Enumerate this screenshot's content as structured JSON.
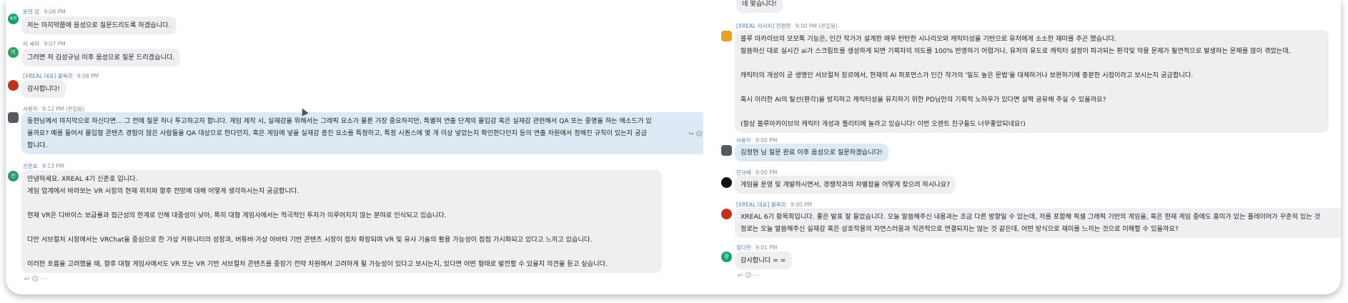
{
  "left": {
    "messages": [
      {
        "sender": "동현 강",
        "time": "9:06 PM",
        "avatar_text": "동현",
        "avatar_color": "#12a46e",
        "lines": [
          "저는 마지막쯤에 음성으로 질문드리도록 하겠습니다."
        ]
      },
      {
        "sender": "이 세라",
        "time": "9:07 PM",
        "avatar_text": "이",
        "avatar_color": "#2aa061",
        "lines": [
          "그러면 저 김성규님 이후 음성으로 질문 드리겠습니다."
        ]
      },
      {
        "sender": "[XREAL 대표] 황목희",
        "time": "9:08 PM",
        "avatar_text": "",
        "avatar_color": "#c0321e",
        "lines": [
          "감사합니다!"
        ]
      },
      {
        "sender": "사용자",
        "time": "9:12 PM (편집됨)",
        "avatar_text": "",
        "avatar_color": "#555a60",
        "lines": [
          "동현님께서 마지막으로 하신다면... 그 전에 질문 하나 투고하고자 합니다. 게임 제작 시, 실재감을 위해서는 그래픽 요소가 물론 가장 중요하지만, 특별히 연출 단계의 몰입감 혹은 실재감 관련해서 QA 또는 중명을 하는 메소드가 있",
          "을까요? 예를 들어서 몰입형 콘텐츠 경험이 많은 사람들을 QA 대상으로 한다던지, 혹은 게임에 넣을 실재감 증진 요소를 특정하고, 특정 시퀀스에 몇 개 이상 넣었는지 확인한다던지 등의 연출 차원에서 정해진 규칙이 있는지 궁금",
          "합니다."
        ]
      },
      {
        "sender": "신준호",
        "time": "9:13 PM",
        "avatar_text": "신",
        "avatar_color": "#2a9a68",
        "lines": [
          "안녕하세요. XREAL 4기 신준호 입니다.",
          "게임 업계에서 바라보는 VR 시장의 현재 위치와 향후 전망에 대해 어떻게 생각하시는지 궁금합니다.",
          "현재 VR은 디바이스 보급률과 접근성의 한계로 인해 대중성이 낮아, 특히 대형 게임사에서는 적극적인 투자가 이루어지지 않는 분야로 인식되고 있습니다.",
          "다만 서브컬처 시장에서는 VRChat을 중심으로 한 가상 커뮤니티의 성장과, 버튜버·가상 아바타 기반 콘텐츠 시장이 점차 확장되며 VR 및 유사 기술의 활용 가능성이 점점 가시화되고 있다고 느끼고 있습니다.",
          "이러한 흐름을 고려했을 때, 향후 대형 게임사에서도 VR 또는 VR 기반 서브컬처 콘텐츠를 중장기 전략 차원에서 고려하게 될 가능성이 있다고 보시는지, 있다면 어떤 형태로 발전할 수 있을지 의견을 듣고 싶습니다."
        ]
      }
    ],
    "hover_icons": "↪ ☺ ⋯",
    "bottom_reactions": "↩ ☺ ⋯"
  },
  "right": {
    "messages": [
      {
        "sender": "",
        "time": "",
        "avatar_text": "",
        "avatar_color": "",
        "lines": [
          "네 맞습니다!"
        ]
      },
      {
        "sender": "[XREAL 리서치] 한정현",
        "time": "9:00 PM (편집됨)",
        "avatar_text": "",
        "avatar_color": "#e8a020",
        "lines": [
          "블루 아카이브의 모모톡 기능은, 인간 작가가 설계한 매우 탄탄한 시나리오와 캐릭터성을 기반으로 유저에게 소소한 재미를 주곤 했습니다.",
          "말씀하신 대로 실시간 ai가 스크립트를 생성하게 되면 기획자의 의도를 100% 반영하기 어렵거나, 유저의 유도로 캐릭터 설정이 파괴되는 환각및 악용 문제가 필연적으로 발생하는 문제를 많이 겪었는데,",
          "캐릭터의 개성이 곧 생명인 서브컬처 장르에서, 현재의 AI 퍼포먼스가 인간 작가의 '밀도 높은 문법'을 대체하거나 보완하기에 충분한 시점이라고 보시는지 궁금합니다.",
          "혹시 이러한 AI의 탈선(환각)을 방지하고 캐릭터성을 유지하기 위한 PD님만의 기획적 노하우가 있다면 살짝 공유해 주실 수 있을까요?",
          "(항상 블루아카이브의 캐릭터 개성과 퀄리티에 놀라고 있습니다! 이번 오렌트 친구들도 너무좋았되네요!)"
        ]
      },
      {
        "sender": "사용자",
        "time": "9:00 PM",
        "avatar_text": "",
        "avatar_color": "#555a60",
        "lines": [
          "김정현 님 질문 완료 이후 음성으로 질문하겠습니다!"
        ]
      },
      {
        "sender": "한규배",
        "time": "9:00 PM",
        "avatar_text": "",
        "avatar_color": "#111111",
        "lines": [
          "게임을 운영 및 개발하시면서, 경쟁작과의 차별점을 어떻게 찾으려 하시나요?"
        ]
      },
      {
        "sender": "[XREAL 대표] 황목희",
        "time": "9:00 PM",
        "avatar_text": "",
        "avatar_color": "#c0321e",
        "lines": [
          "XREAL 6기 황목희입니다. 좋은 발표 잘 들었습니다. 오늘 말씀해주신 내용과는 조금 다른 방향일 수 있는데, 저를 포함해 픽셀 그래픽 기반의 게임을, 혹은 현재 게임 중에도 흥미가 있는 플레이어가 꾸준히 있는 것",
          "정로는 오늘 말씀해주신 실재감 혹은 상호작용의 자연스러움과 직관적으로 연결되지는 않는 것 같은데, 어떤 방식으로 재미를 느끼는 것으로 이해할 수 있을까요?"
        ]
      },
      {
        "sender": "정다현",
        "time": "9:01 PM",
        "avatar_text": "정",
        "avatar_color": "#12a46e",
        "lines": [
          "감사합니다 = ="
        ]
      }
    ],
    "bottom_reactions": "↩ ☺ ⋯"
  }
}
